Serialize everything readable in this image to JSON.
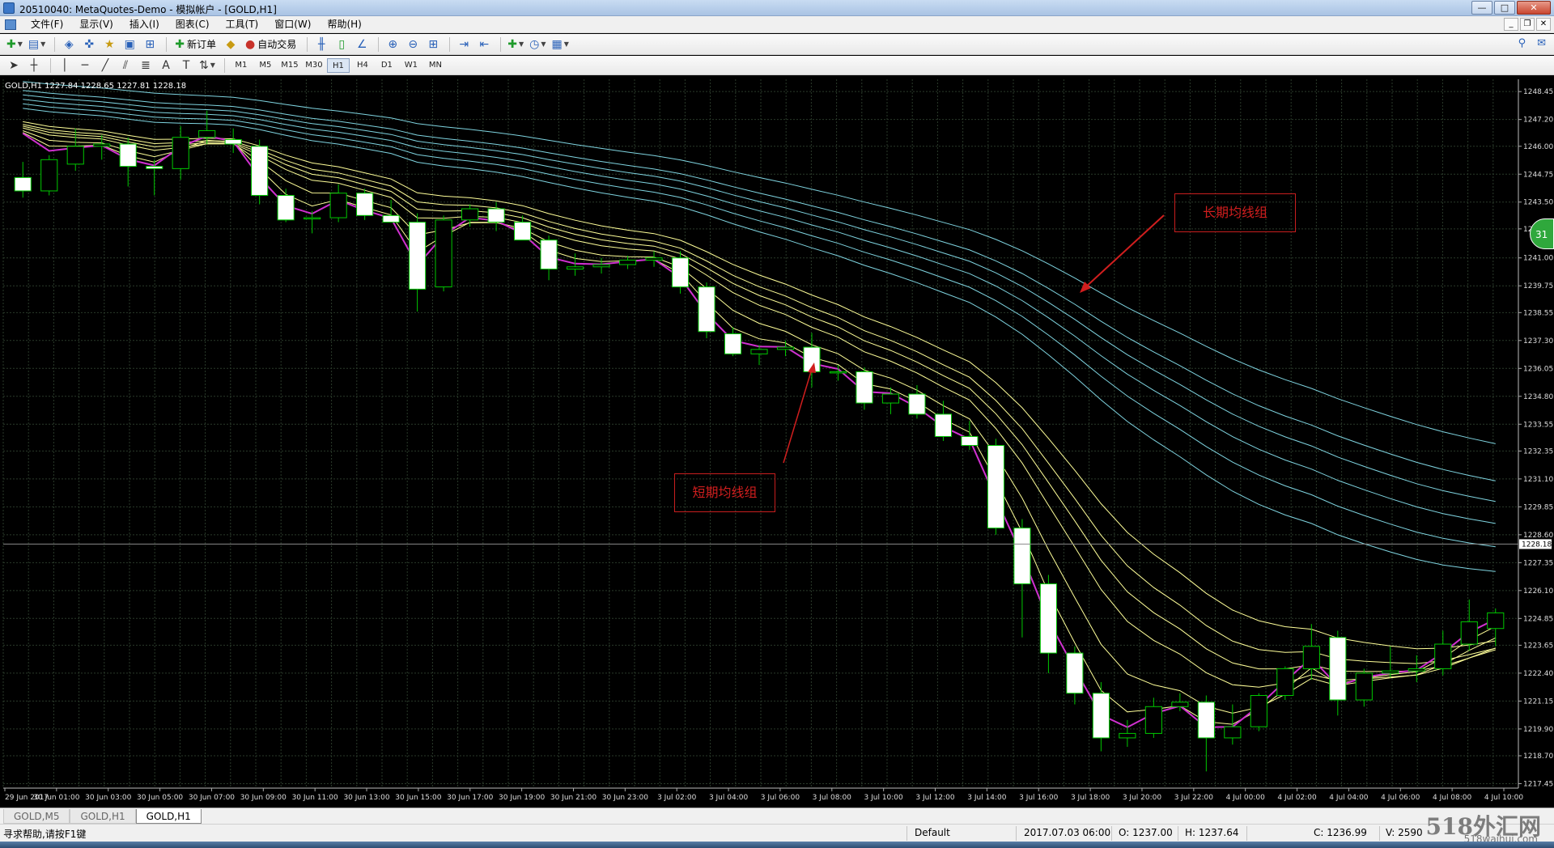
{
  "window": {
    "title": "20510040: MetaQuotes-Demo - 模拟帐户 - [GOLD,H1]",
    "min_label": "—",
    "max_label": "□",
    "close_label": "✕"
  },
  "menu": {
    "items": [
      "文件(F)",
      "显示(V)",
      "插入(I)",
      "图表(C)",
      "工具(T)",
      "窗口(W)",
      "帮助(H)"
    ],
    "mdi_min": "_",
    "mdi_restore": "❐",
    "mdi_close": "✕"
  },
  "toolbar": {
    "new_order_label": "新订单",
    "auto_trade_label": "自动交易",
    "timeframes": [
      "M1",
      "M5",
      "M15",
      "M30",
      "H1",
      "H4",
      "D1",
      "W1",
      "MN"
    ],
    "active_timeframe": "H1",
    "text_tool": "A",
    "label_tool": "T"
  },
  "chart": {
    "symbol_info": "GOLD,H1  1227.84 1228.65 1227.81 1228.18",
    "current_price": "1228.18",
    "badge_text": "31",
    "colors": {
      "candle_body": "#ffffff",
      "candle_outline": "#00c800",
      "grid": "#2a3a2a",
      "short_ma": "#ffff99",
      "long_ma": "#7fd4e0",
      "fast_ma": "#d030d0",
      "annotation": "#d01e1e"
    },
    "annotations": {
      "long_group": "长期均线组",
      "short_group": "短期均线组"
    }
  },
  "chart_data": {
    "type": "candlestick",
    "title": "",
    "ylim": [
      1217.25,
      1249.0
    ],
    "y_ticks": [
      "1248.45",
      "1247.20",
      "1246.00",
      "1244.75",
      "1243.50",
      "1242.30",
      "1241.00",
      "1239.75",
      "1238.55",
      "1237.30",
      "1236.05",
      "1234.80",
      "1233.55",
      "1232.35",
      "1231.10",
      "1229.85",
      "1228.60",
      "1227.35",
      "1226.10",
      "1224.85",
      "1223.65",
      "1222.40",
      "1221.15",
      "1219.90",
      "1218.70",
      "1217.45"
    ],
    "x_ticks": [
      "29 Jun 2017",
      "30 Jun 01:00",
      "30 Jun 03:00",
      "30 Jun 05:00",
      "30 Jun 07:00",
      "30 Jun 09:00",
      "30 Jun 11:00",
      "30 Jun 13:00",
      "30 Jun 15:00",
      "30 Jun 17:00",
      "30 Jun 19:00",
      "30 Jun 21:00",
      "30 Jun 23:00",
      "3 Jul 02:00",
      "3 Jul 04:00",
      "3 Jul 06:00",
      "3 Jul 08:00",
      "3 Jul 10:00",
      "3 Jul 12:00",
      "3 Jul 14:00",
      "3 Jul 16:00",
      "3 Jul 18:00",
      "3 Jul 20:00",
      "3 Jul 22:00",
      "4 Jul 00:00",
      "4 Jul 02:00",
      "4 Jul 04:00",
      "4 Jul 06:00",
      "4 Jul 08:00",
      "4 Jul 10:00"
    ],
    "candles": [
      {
        "o": 1244.6,
        "h": 1245.3,
        "l": 1243.7,
        "c": 1244.0
      },
      {
        "o": 1244.0,
        "h": 1245.6,
        "l": 1243.8,
        "c": 1245.4
      },
      {
        "o": 1245.2,
        "h": 1246.8,
        "l": 1244.9,
        "c": 1246.0
      },
      {
        "o": 1246.0,
        "h": 1246.5,
        "l": 1245.4,
        "c": 1246.1
      },
      {
        "o": 1246.1,
        "h": 1246.4,
        "l": 1244.2,
        "c": 1245.1
      },
      {
        "o": 1245.1,
        "h": 1245.4,
        "l": 1243.8,
        "c": 1245.0
      },
      {
        "o": 1245.0,
        "h": 1246.9,
        "l": 1244.5,
        "c": 1246.4
      },
      {
        "o": 1246.4,
        "h": 1247.6,
        "l": 1246.1,
        "c": 1246.7
      },
      {
        "o": 1246.3,
        "h": 1246.8,
        "l": 1245.7,
        "c": 1246.1
      },
      {
        "o": 1246.0,
        "h": 1246.3,
        "l": 1243.4,
        "c": 1243.8
      },
      {
        "o": 1243.8,
        "h": 1244.1,
        "l": 1242.6,
        "c": 1242.7
      },
      {
        "o": 1242.8,
        "h": 1243.1,
        "l": 1242.1,
        "c": 1242.8
      },
      {
        "o": 1242.8,
        "h": 1244.3,
        "l": 1242.6,
        "c": 1243.9
      },
      {
        "o": 1243.9,
        "h": 1244.1,
        "l": 1242.7,
        "c": 1242.9
      },
      {
        "o": 1242.9,
        "h": 1243.6,
        "l": 1242.6,
        "c": 1242.6
      },
      {
        "o": 1242.6,
        "h": 1243.0,
        "l": 1238.6,
        "c": 1239.6
      },
      {
        "o": 1239.7,
        "h": 1242.9,
        "l": 1239.5,
        "c": 1242.7
      },
      {
        "o": 1242.7,
        "h": 1243.4,
        "l": 1242.4,
        "c": 1243.2
      },
      {
        "o": 1243.2,
        "h": 1243.5,
        "l": 1242.2,
        "c": 1242.6
      },
      {
        "o": 1242.6,
        "h": 1242.9,
        "l": 1241.8,
        "c": 1241.8
      },
      {
        "o": 1241.8,
        "h": 1242.0,
        "l": 1240.0,
        "c": 1240.5
      },
      {
        "o": 1240.5,
        "h": 1241.2,
        "l": 1240.2,
        "c": 1240.6
      },
      {
        "o": 1240.6,
        "h": 1241.0,
        "l": 1240.3,
        "c": 1240.7
      },
      {
        "o": 1240.7,
        "h": 1241.1,
        "l": 1240.5,
        "c": 1240.9
      },
      {
        "o": 1240.9,
        "h": 1241.3,
        "l": 1240.6,
        "c": 1241.0
      },
      {
        "o": 1241.0,
        "h": 1241.3,
        "l": 1239.4,
        "c": 1239.7
      },
      {
        "o": 1239.7,
        "h": 1239.9,
        "l": 1237.4,
        "c": 1237.7
      },
      {
        "o": 1237.6,
        "h": 1237.9,
        "l": 1236.6,
        "c": 1236.7
      },
      {
        "o": 1236.7,
        "h": 1237.1,
        "l": 1236.2,
        "c": 1236.9
      },
      {
        "o": 1236.9,
        "h": 1237.3,
        "l": 1236.6,
        "c": 1237.0
      },
      {
        "o": 1237.0,
        "h": 1237.64,
        "l": 1235.2,
        "c": 1235.9
      },
      {
        "o": 1235.9,
        "h": 1236.2,
        "l": 1235.5,
        "c": 1235.9
      },
      {
        "o": 1235.9,
        "h": 1236.1,
        "l": 1234.2,
        "c": 1234.5
      },
      {
        "o": 1234.5,
        "h": 1235.2,
        "l": 1234.0,
        "c": 1234.9
      },
      {
        "o": 1234.9,
        "h": 1235.3,
        "l": 1233.8,
        "c": 1234.0
      },
      {
        "o": 1234.0,
        "h": 1234.6,
        "l": 1232.8,
        "c": 1233.0
      },
      {
        "o": 1233.0,
        "h": 1233.7,
        "l": 1232.4,
        "c": 1232.6
      },
      {
        "o": 1232.6,
        "h": 1232.9,
        "l": 1228.6,
        "c": 1228.9
      },
      {
        "o": 1228.9,
        "h": 1229.3,
        "l": 1224.0,
        "c": 1226.4
      },
      {
        "o": 1226.4,
        "h": 1226.8,
        "l": 1222.4,
        "c": 1223.3
      },
      {
        "o": 1223.3,
        "h": 1223.6,
        "l": 1221.0,
        "c": 1221.5
      },
      {
        "o": 1221.5,
        "h": 1222.0,
        "l": 1218.9,
        "c": 1219.5
      },
      {
        "o": 1219.5,
        "h": 1220.3,
        "l": 1219.1,
        "c": 1219.7
      },
      {
        "o": 1219.7,
        "h": 1221.3,
        "l": 1219.5,
        "c": 1220.9
      },
      {
        "o": 1220.9,
        "h": 1221.5,
        "l": 1220.7,
        "c": 1221.1
      },
      {
        "o": 1221.1,
        "h": 1221.4,
        "l": 1218.0,
        "c": 1219.5
      },
      {
        "o": 1219.5,
        "h": 1221.0,
        "l": 1219.2,
        "c": 1220.0
      },
      {
        "o": 1220.0,
        "h": 1221.5,
        "l": 1219.8,
        "c": 1221.4
      },
      {
        "o": 1221.4,
        "h": 1222.7,
        "l": 1221.2,
        "c": 1222.6
      },
      {
        "o": 1222.6,
        "h": 1224.6,
        "l": 1222.1,
        "c": 1223.6
      },
      {
        "o": 1224.0,
        "h": 1224.3,
        "l": 1220.5,
        "c": 1221.2
      },
      {
        "o": 1221.2,
        "h": 1222.6,
        "l": 1220.9,
        "c": 1222.4
      },
      {
        "o": 1222.4,
        "h": 1223.6,
        "l": 1222.2,
        "c": 1222.5
      },
      {
        "o": 1222.5,
        "h": 1223.2,
        "l": 1222.0,
        "c": 1222.6
      },
      {
        "o": 1222.6,
        "h": 1224.3,
        "l": 1222.3,
        "c": 1223.7
      },
      {
        "o": 1223.7,
        "h": 1225.7,
        "l": 1223.4,
        "c": 1224.7
      },
      {
        "o": 1224.4,
        "h": 1225.3,
        "l": 1223.6,
        "c": 1225.1
      }
    ]
  },
  "chart_tabs": [
    "GOLD,M5",
    "GOLD,H1",
    "GOLD,H1"
  ],
  "active_tab_index": 2,
  "status": {
    "help": "寻求帮助,请按F1键",
    "profile": "Default",
    "datetime": "2017.07.03 06:00",
    "open": "O: 1237.00",
    "high": "H: 1237.64",
    "close": "C: 1236.99",
    "volume": "V: 2590"
  },
  "watermark": {
    "main": "518外汇网",
    "sub": "518waihui.com"
  }
}
